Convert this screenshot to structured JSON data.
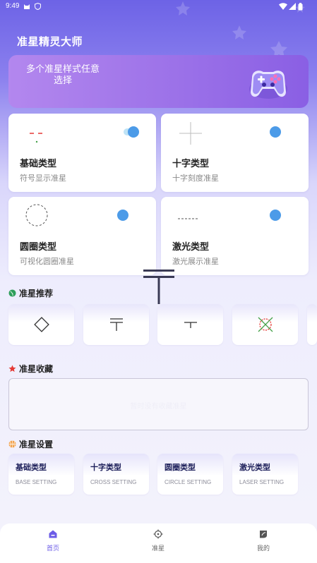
{
  "status_bar": {
    "time": "9:49"
  },
  "app_title": "准星精灵大师",
  "banner": {
    "text": "多个准星样式任意选择"
  },
  "type_cards": [
    {
      "title": "基础类型",
      "subtitle": "符号显示准星"
    },
    {
      "title": "十字类型",
      "subtitle": "十字刻度准星"
    },
    {
      "title": "圆圈类型",
      "subtitle": "可视化圆圈准星"
    },
    {
      "title": "激光类型",
      "subtitle": "激光展示准星"
    }
  ],
  "recommend": {
    "title": "准星推荐"
  },
  "favorites": {
    "title": "准星收藏",
    "empty_text": "暂时没有收藏准星"
  },
  "settings": {
    "title": "准星设置",
    "items": [
      {
        "title": "基础类型",
        "subtitle": "BASE SETTING"
      },
      {
        "title": "十字类型",
        "subtitle": "CROSS SETTING"
      },
      {
        "title": "圆圈类型",
        "subtitle": "CIRCLE SETTING"
      },
      {
        "title": "激光类型",
        "subtitle": "LASER SETTING"
      }
    ]
  },
  "bottom_nav": [
    {
      "label": "首页",
      "icon": "home-icon"
    },
    {
      "label": "准星",
      "icon": "crosshair-icon"
    },
    {
      "label": "我的",
      "icon": "profile-icon"
    }
  ],
  "colors": {
    "accent": "#6c5ce7",
    "toggle": "#4c9be8",
    "banner": "#9a70e8"
  }
}
